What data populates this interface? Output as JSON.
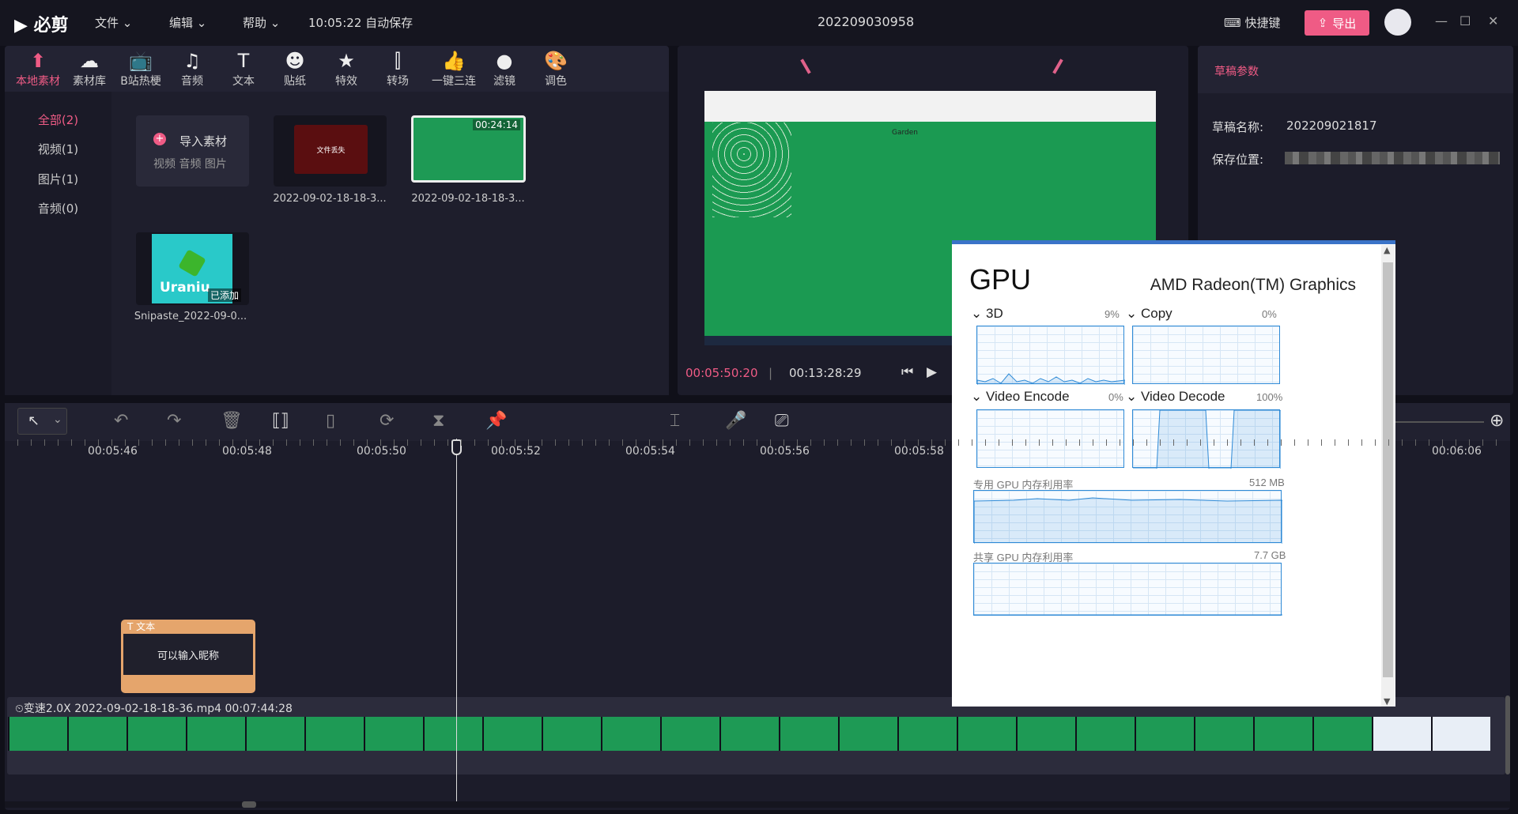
{
  "topbar": {
    "app_name": "必剪",
    "menus": [
      "文件",
      "编辑",
      "帮助"
    ],
    "autosave": "10:05:22 自动保存",
    "project_name": "202209030958",
    "shortcut_label": "快捷键",
    "export_label": "导出"
  },
  "library": {
    "tabs": [
      {
        "label": "本地素材",
        "icon": "upload-icon"
      },
      {
        "label": "素材库",
        "icon": "cloud-icon"
      },
      {
        "label": "B站热梗",
        "icon": "tv-icon"
      },
      {
        "label": "音频",
        "icon": "music-icon"
      },
      {
        "label": "文本",
        "icon": "text-icon"
      },
      {
        "label": "贴纸",
        "icon": "sticker-icon"
      },
      {
        "label": "特效",
        "icon": "star-icon"
      },
      {
        "label": "转场",
        "icon": "transition-icon"
      },
      {
        "label": "一键三连",
        "icon": "thumb-icon"
      },
      {
        "label": "滤镜",
        "icon": "filter-icon"
      },
      {
        "label": "调色",
        "icon": "palette-icon"
      }
    ],
    "categories": [
      "全部(2)",
      "视频(1)",
      "图片(1)",
      "音频(0)"
    ],
    "import_label": "导入素材",
    "import_sub": "视频  音频  图片",
    "assets": [
      {
        "name": "2022-09-02-18-18-3...",
        "badge": "文件丢失"
      },
      {
        "name": "2022-09-02-18-18-3...",
        "duration": "00:24:14"
      },
      {
        "name": "Snipaste_2022-09-0...",
        "overlay": "已添加",
        "thumb_text": "Uraniu"
      }
    ]
  },
  "preview": {
    "game_title": "Garden",
    "current_time": "00:05:50:20",
    "total_time": "00:13:28:29"
  },
  "draft": {
    "title": "草稿参数",
    "name_label": "草稿名称:",
    "name_value": "202209021817",
    "location_label": "保存位置:"
  },
  "timeline": {
    "ruler_labels": [
      "00:05:46",
      "00:05:48",
      "00:05:50",
      "00:05:52",
      "00:05:54",
      "00:05:56",
      "00:05:58",
      "00:06:06"
    ],
    "text_clip_header": "文本",
    "text_clip_body": "可以输入昵称",
    "video_clip_label": "⏲变速2.0X 2022-09-02-18-18-36.mp4    00:07:44:28"
  },
  "gpu_panel": {
    "title": "GPU",
    "model": "AMD Radeon(TM) Graphics",
    "engines": [
      {
        "name": "3D",
        "percent": "9%"
      },
      {
        "name": "Copy",
        "percent": "0%"
      },
      {
        "name": "Video Encode",
        "percent": "0%"
      },
      {
        "name": "Video Decode",
        "percent": "100%"
      }
    ],
    "dedicated_label": "专用 GPU 内存利用率",
    "dedicated_value": "512 MB",
    "shared_label": "共享 GPU 内存利用率",
    "shared_value": "7.7 GB"
  },
  "colors": {
    "accent": "#ef5b85",
    "clip_green": "#1e9a55",
    "text_clip": "#e5a56c",
    "gpu_line": "#2e8ad6"
  }
}
